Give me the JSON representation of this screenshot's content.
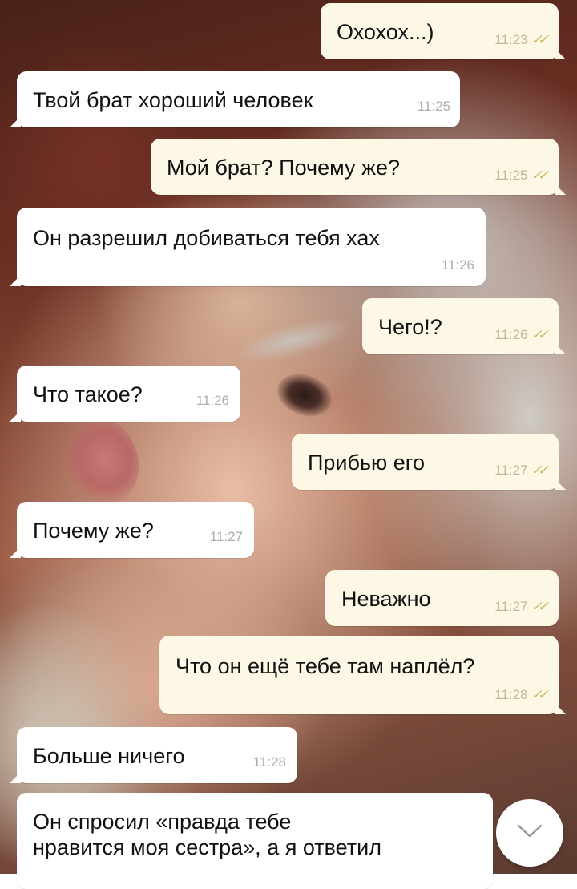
{
  "wallpaper": {
    "type": "photo",
    "subject": "portrait-background"
  },
  "messages": [
    {
      "direction": "out",
      "text": "Охохох...)",
      "time": "11:23",
      "status": "read"
    },
    {
      "direction": "in",
      "text": "Твой брат хороший человек",
      "time": "11:25"
    },
    {
      "direction": "out",
      "text": "Мой брат? Почему же?",
      "time": "11:25",
      "status": "read"
    },
    {
      "direction": "in",
      "text": "Он разрешил добиваться тебя хах",
      "time": "11:26"
    },
    {
      "direction": "out",
      "text": "Чего!?",
      "time": "11:26",
      "status": "read"
    },
    {
      "direction": "in",
      "text": "Что такое?",
      "time": "11:26"
    },
    {
      "direction": "out",
      "text": "Прибью его",
      "time": "11:27",
      "status": "read"
    },
    {
      "direction": "in",
      "text": "Почему же?",
      "time": "11:27"
    },
    {
      "direction": "out",
      "text": "Неважно",
      "time": "11:27",
      "status": "read"
    },
    {
      "direction": "out",
      "text": "Что он ещё тебе там наплёл?",
      "time": "11:28",
      "status": "read"
    },
    {
      "direction": "in",
      "text": "Больше ничего",
      "time": "11:28"
    },
    {
      "direction": "in",
      "text": "Он спросил «правда тебе\nнравится моя сестра», а я ответил"
    }
  ],
  "icons": {
    "scroll_down": "chevron-down-icon",
    "read_status": "double-check-icon"
  },
  "colors": {
    "incoming_bubble": "#ffffff",
    "outgoing_bubble": "#fdf8e5",
    "read_ticks": "#c7b35a",
    "time_text": "#b0aca5"
  }
}
